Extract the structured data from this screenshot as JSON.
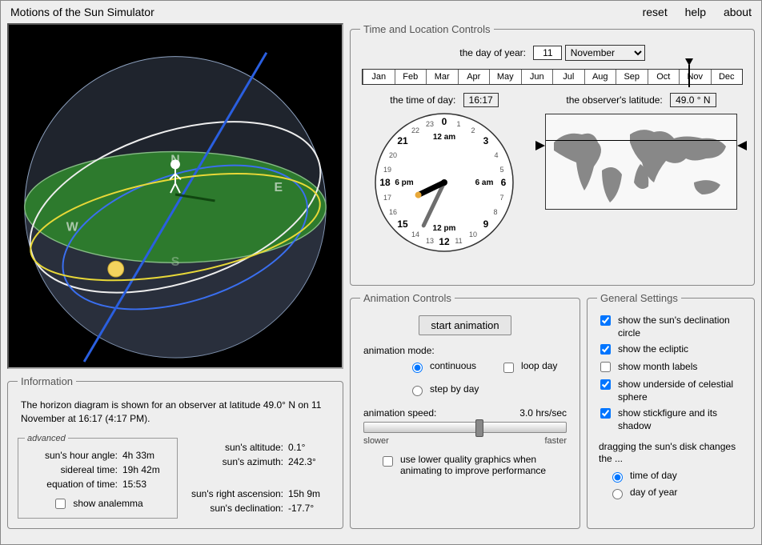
{
  "title": "Motions of the Sun Simulator",
  "menu": {
    "reset": "reset",
    "help": "help",
    "about": "about"
  },
  "info": {
    "legend": "Information",
    "text": "The horizon diagram is shown for an observer at latitude 49.0° N on 11 November at 16:17 (4:17 PM).",
    "advanced_legend": "advanced",
    "hour_angle_label": "sun's hour angle:",
    "hour_angle": "4h 33m",
    "sidereal_label": "sidereal time:",
    "sidereal": "19h 42m",
    "eot_label": "equation of time:",
    "eot": "15:53",
    "analemma_label": "show analemma",
    "altitude_label": "sun's altitude:",
    "altitude": "0.1°",
    "azimuth_label": "sun's azimuth:",
    "azimuth": "242.3°",
    "ra_label": "sun's right ascension:",
    "ra": "15h 9m",
    "dec_label": "sun's declination:",
    "dec": "-17.7°"
  },
  "timeloc": {
    "legend": "Time and Location Controls",
    "doy_label": "the day of year:",
    "day": "11",
    "month": "November",
    "months": [
      "Jan",
      "Feb",
      "Mar",
      "Apr",
      "May",
      "Jun",
      "Jul",
      "Aug",
      "Sep",
      "Oct",
      "Nov",
      "Dec"
    ],
    "marker_pct": 86,
    "tod_label": "the time of day:",
    "tod": "16:17",
    "lat_label": "the observer's latitude:",
    "lat": "49.0 ° N",
    "clock": {
      "labels_bold": [
        "0",
        "3",
        "6",
        "9",
        "12",
        "15",
        "18",
        "21"
      ],
      "am": "12 am",
      "pm": "12 pm",
      "sixam": "6 am",
      "sixpm": "6 pm"
    }
  },
  "anim": {
    "legend": "Animation Controls",
    "start": "start animation",
    "mode_label": "animation mode:",
    "continuous": "continuous",
    "loop": "loop day",
    "step": "step by day",
    "speed_label": "animation speed:",
    "speed": "3.0 hrs/sec",
    "slower": "slower",
    "faster": "faster",
    "lowq": "use lower quality graphics when animating to improve performance"
  },
  "gen": {
    "legend": "General Settings",
    "decl": "show the sun's declination circle",
    "ecliptic": "show the ecliptic",
    "monthlabels": "show month labels",
    "underside": "show underside of celestial sphere",
    "stick": "show stickfigure and its shadow",
    "dragnote": "dragging the sun's disk changes the ...",
    "tod": "time of day",
    "doy": "day of year"
  }
}
